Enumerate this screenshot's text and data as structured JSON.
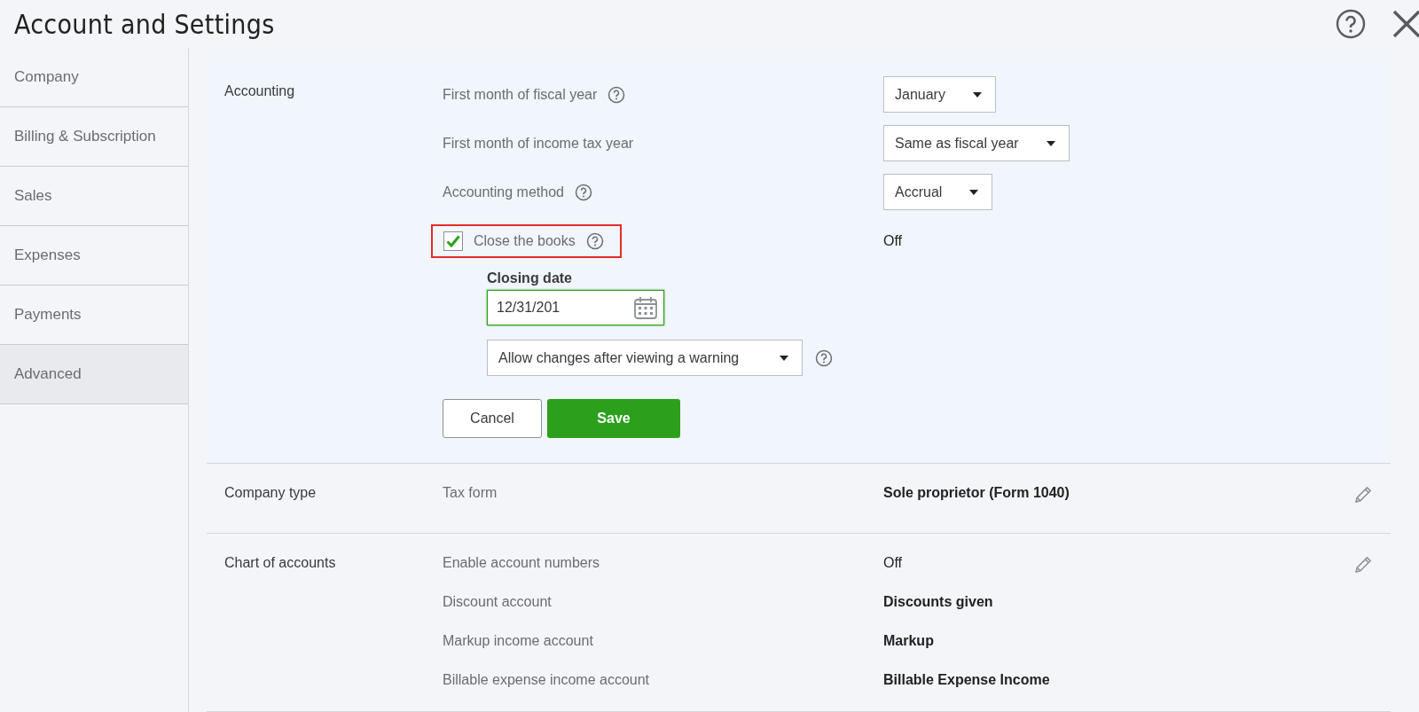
{
  "header": {
    "title": "Account and Settings"
  },
  "sidebar": {
    "items": [
      {
        "label": "Company",
        "selected": false
      },
      {
        "label": "Billing & Subscription",
        "selected": false
      },
      {
        "label": "Sales",
        "selected": false
      },
      {
        "label": "Expenses",
        "selected": false
      },
      {
        "label": "Payments",
        "selected": false
      },
      {
        "label": "Advanced",
        "selected": true
      }
    ]
  },
  "accounting": {
    "label": "Accounting",
    "settings": [
      {
        "kind": "select",
        "label": "First month of fiscal year",
        "help": true,
        "value": "January"
      },
      {
        "kind": "select",
        "label": "First month of income tax year",
        "help": false,
        "value": "Same as fiscal year"
      },
      {
        "kind": "select",
        "label": "Accounting method",
        "help": true,
        "value": "Accrual"
      },
      {
        "kind": "checkbox",
        "label": "Close the books",
        "help": true,
        "checked": true,
        "highlighted": true,
        "value": "Off"
      }
    ],
    "closing_date": {
      "label": "Closing date",
      "value": "12/31/201"
    },
    "change_policy": {
      "value": "Allow changes after viewing a warning",
      "help": true
    },
    "buttons": [
      {
        "kind": "secondary",
        "label": "Cancel"
      },
      {
        "kind": "primary",
        "label": "Save"
      }
    ]
  },
  "sections": [
    {
      "label": "Company type",
      "editable": true,
      "rows": [
        {
          "label": "Tax form",
          "value": "Sole proprietor (Form 1040)",
          "bold": true
        }
      ]
    },
    {
      "label": "Chart of accounts",
      "editable": true,
      "rows": [
        {
          "label": "Enable account numbers",
          "value": "Off",
          "bold": false
        },
        {
          "label": "Discount account",
          "value": "Discounts given",
          "bold": true
        },
        {
          "label": "Markup income account",
          "value": "Markup",
          "bold": true
        },
        {
          "label": "Billable expense income account",
          "value": "Billable Expense Income",
          "bold": true
        }
      ]
    }
  ]
}
